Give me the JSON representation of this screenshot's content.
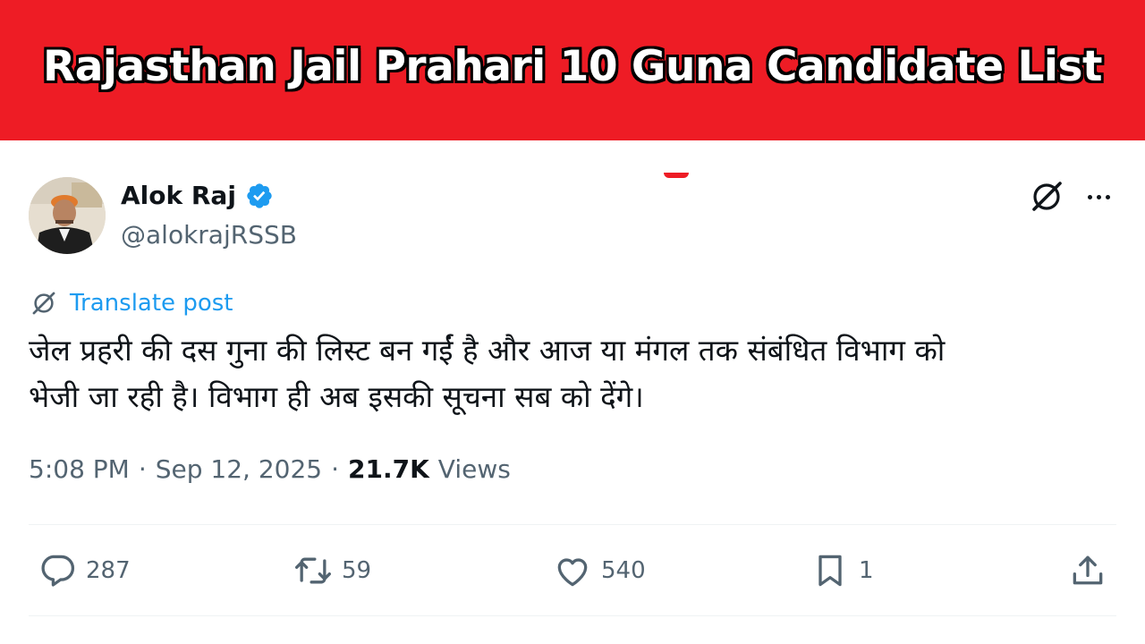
{
  "banner": {
    "title": "Rajasthan Jail Prahari 10 Guna Candidate List",
    "bg_color": "#ee1c25"
  },
  "post": {
    "author": {
      "name": "Alok Raj",
      "handle": "@alokrajRSSB",
      "verified": true
    },
    "translate_label": "Translate post",
    "text_lines": [
      "जेल प्रहरी की दस गुना की लिस्ट बन गईं है और आज या मंगल तक संबंधित विभाग को",
      "भेजी जा रही है। विभाग ही अब इसकी सूचना सब को देंगे।"
    ],
    "meta": {
      "time": "5:08 PM",
      "separator": "·",
      "date": "Sep 12, 2025",
      "views_count": "21.7K",
      "views_label": "Views"
    },
    "actions": {
      "replies": "287",
      "reposts": "59",
      "likes": "540",
      "bookmarks": "1"
    },
    "icons": {
      "grok": "grok-icon",
      "more": "more-horizontal-icon",
      "reply": "comment-icon",
      "repost": "repost-icon",
      "like": "heart-icon",
      "bookmark": "bookmark-icon",
      "share": "share-icon"
    },
    "colors": {
      "link": "#1d9bf0",
      "muted": "#536471",
      "text": "#0f1419",
      "verified": "#1d9bf0"
    }
  }
}
